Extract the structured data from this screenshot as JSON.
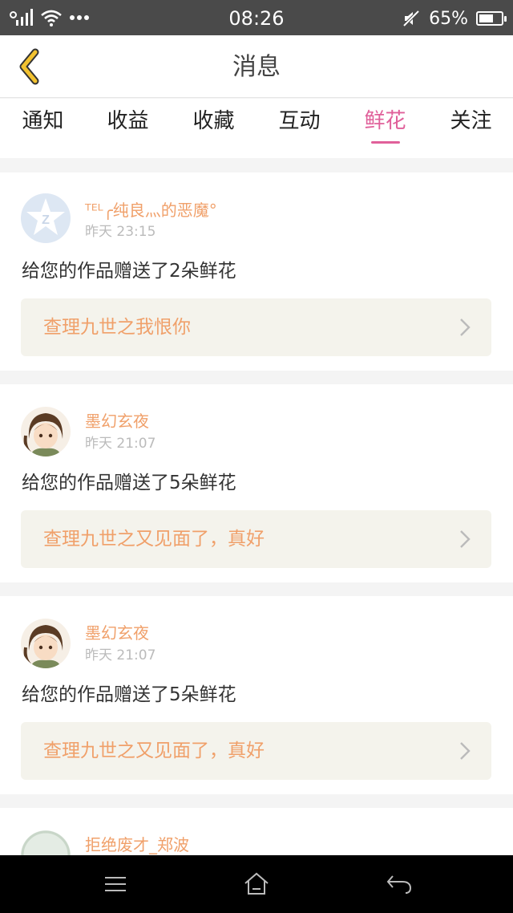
{
  "status_bar": {
    "time": "08:26",
    "battery_percent": "65%",
    "battery_level": 0.65,
    "icons": [
      "signal-icon",
      "wifi-icon",
      "more-dots-icon",
      "mute-icon",
      "battery-icon"
    ]
  },
  "header": {
    "title": "消息",
    "back_icon": "chevron-left-icon"
  },
  "tabs": [
    {
      "label": "通知",
      "active": false
    },
    {
      "label": "收益",
      "active": false
    },
    {
      "label": "收藏",
      "active": false
    },
    {
      "label": "互动",
      "active": false
    },
    {
      "label": "鲜花",
      "active": true
    },
    {
      "label": "关注",
      "active": false
    }
  ],
  "messages": [
    {
      "name": "ᵀᴱᴸ╭纯良灬的恶魔°",
      "time": "昨天 23:15",
      "text": "给您的作品赠送了2朵鲜花",
      "work": "查理九世之我恨你",
      "avatar": "default-avatar-icon"
    },
    {
      "name": "墨幻玄夜",
      "time": "昨天 21:07",
      "text": "给您的作品赠送了5朵鲜花",
      "work": "查理九世之又见面了，真好",
      "avatar": "anime-avatar"
    },
    {
      "name": "墨幻玄夜",
      "time": "昨天 21:07",
      "text": "给您的作品赠送了5朵鲜花",
      "work": "查理九世之又见面了，真好",
      "avatar": "anime-avatar"
    },
    {
      "name": "拒绝废才_郑波",
      "avatar": "user-avatar"
    }
  ],
  "colors": {
    "accent": "#e0609a",
    "name_color": "#f0a06a",
    "back_arrow": "#f2c230"
  },
  "nav": [
    "menu-icon",
    "home-icon",
    "back-icon"
  ]
}
